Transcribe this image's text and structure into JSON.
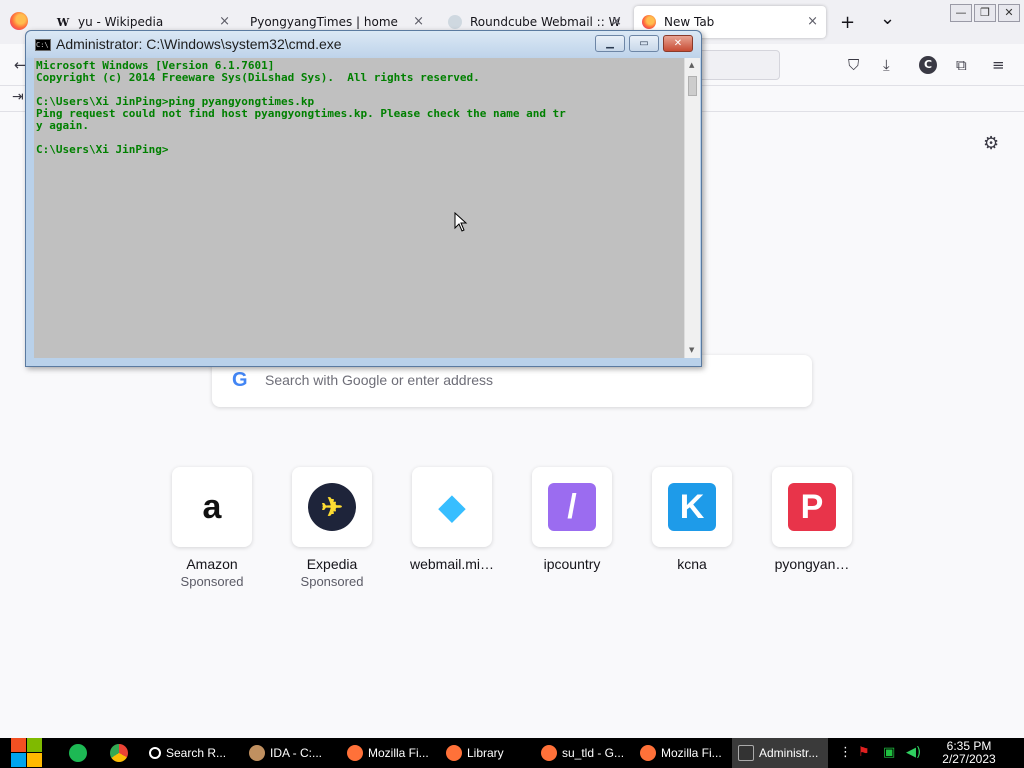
{
  "browser": {
    "tabs": [
      {
        "label": "yu - Wikipedia",
        "favicon": "W",
        "close": "×"
      },
      {
        "label": "PyongyangTimes | home",
        "favicon": "",
        "close": "×"
      },
      {
        "label": "Roundcube Webmail :: W",
        "favicon": "",
        "close": "×"
      },
      {
        "label": "New Tab",
        "favicon": "",
        "close": "×"
      }
    ],
    "new_tab_symbol": "+",
    "tab_list_symbol": "⌄",
    "profile_initial": "C"
  },
  "newtab": {
    "search_placeholder": "Search with Google or enter address",
    "google_letter": "G",
    "shortcuts": [
      {
        "name": "Amazon",
        "sponsored": "Sponsored",
        "icon": "amazon-icon",
        "glyph": "a",
        "bg": "#ffffff",
        "fg": "#111111"
      },
      {
        "name": "Expedia",
        "sponsored": "Sponsored",
        "icon": "expedia-icon",
        "glyph": "✈",
        "bg": "#1e243a",
        "fg": "#fddb32"
      },
      {
        "name": "webmail.mi…",
        "sponsored": "",
        "icon": "roundcube-icon",
        "glyph": "◆",
        "bg": "#ffffff",
        "fg": "#37beff"
      },
      {
        "name": "ipcountry",
        "sponsored": "",
        "icon": "ipcountry-icon",
        "glyph": "/",
        "bg": "#9b6cf0",
        "fg": "#ffffff"
      },
      {
        "name": "kcna",
        "sponsored": "",
        "icon": "kcna-icon",
        "glyph": "K",
        "bg": "#1e9be9",
        "fg": "#ffffff"
      },
      {
        "name": "pyongyan…",
        "sponsored": "",
        "icon": "pyongyang-icon",
        "glyph": "P",
        "bg": "#e8344a",
        "fg": "#ffffff"
      }
    ]
  },
  "cmd": {
    "title": "Administrator: C:\\Windows\\system32\\cmd.exe",
    "icon_text": "C:\\",
    "lines": [
      "Microsoft Windows [Version 6.1.7601]",
      "Copyright (c) 2014 Freeware Sys(DiLshad Sys).  All rights reserved.",
      "",
      "C:\\Users\\Xi JinPing>ping pyangyongtimes.kp",
      "Ping request could not find host pyangyongtimes.kp. Please check the name and tr",
      "y again.",
      "",
      "C:\\Users\\Xi JinPing>"
    ]
  },
  "taskbar": {
    "items": [
      {
        "label": "Search R...",
        "icon": "search-icon"
      },
      {
        "label": "IDA - C:...",
        "icon": "ida-icon"
      },
      {
        "label": "Mozilla Fi...",
        "icon": "firefox-icon"
      },
      {
        "label": "Library",
        "icon": "firefox-icon"
      },
      {
        "label": "su_tld - G...",
        "icon": "firefox-icon"
      },
      {
        "label": "Mozilla Fi...",
        "icon": "firefox-icon"
      },
      {
        "label": "Administr...",
        "icon": "cmd-icon"
      }
    ],
    "time": "6:35 PM",
    "date": "2/27/2023"
  }
}
